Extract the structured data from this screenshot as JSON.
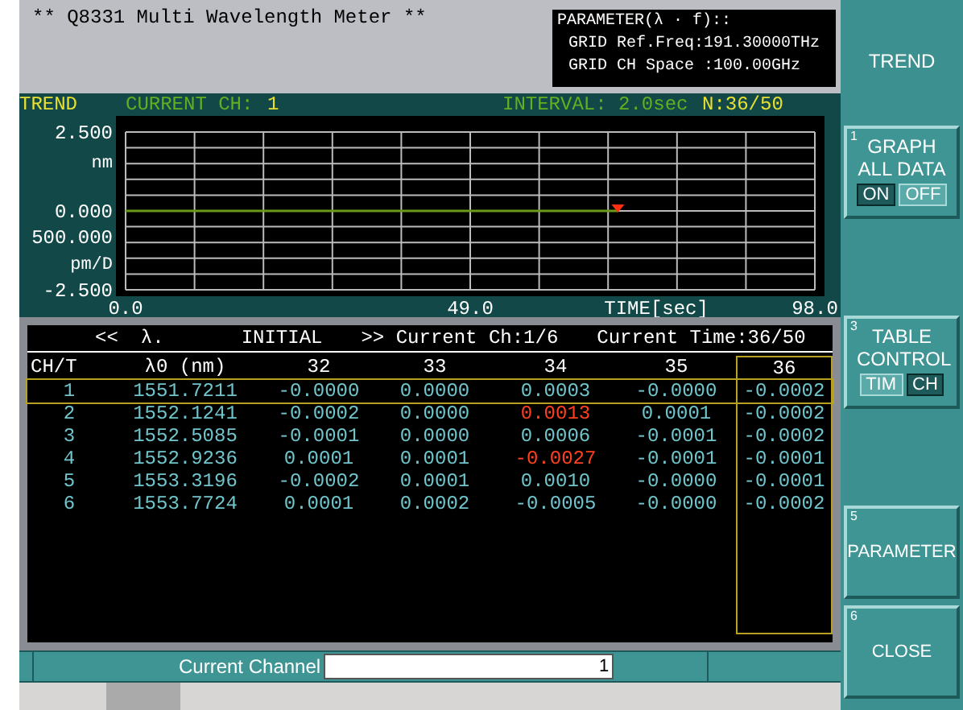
{
  "window": {
    "title": "** Q8331 Multi Wavelength Meter **"
  },
  "parameter_box": {
    "lines": [
      "PARAMETER(λ · f)::",
      "GRID Ref.Freq:191.30000THz",
      "GRID CH Space :100.00GHz"
    ]
  },
  "trend_bar": {
    "mode": "TREND",
    "current_ch_label": "CURRENT CH:",
    "current_ch": "1",
    "interval": "INTERVAL: 2.0sec",
    "count": "N:36/50"
  },
  "chart": {
    "scale2": "500.000",
    "scale2_unit": "pm/D",
    "chart_data": {
      "type": "line",
      "xlabel": "TIME[sec]",
      "ylabel": "nm",
      "xlim": [
        0,
        98
      ],
      "ylim": [
        -2.5,
        2.5
      ],
      "xticks": [
        {
          "value": 0,
          "label": "0.0"
        },
        {
          "value": 49,
          "label": "49.0"
        },
        {
          "value": 98,
          "label": "98.0"
        }
      ],
      "yticks": [
        {
          "value": 2.5,
          "label": "2.500"
        },
        {
          "value": 0,
          "label": "0.000"
        },
        {
          "value": -2.5,
          "label": "-2.500"
        }
      ],
      "x": [
        0,
        70
      ],
      "series": [
        {
          "color": "#6a9a1a",
          "values": [
            0,
            0
          ]
        }
      ]
    }
  },
  "table": {
    "header": [
      "<<",
      "λ.",
      "INITIAL",
      ">> Current Ch:1/6",
      "Current Time:36/50"
    ],
    "columns": [
      {
        "label": "CH/T",
        "selected": false
      },
      {
        "label": "λ0 (nm)",
        "selected": false
      },
      {
        "label": "32",
        "selected": false
      },
      {
        "label": "33",
        "selected": false
      },
      {
        "label": "34",
        "selected": false
      },
      {
        "label": "35",
        "selected": false
      },
      {
        "label": "36",
        "selected": true
      }
    ],
    "rows": [
      {
        "ch": "1",
        "lambda0": "1551.7211",
        "selected": true,
        "values": [
          {
            "text": "-0.0000",
            "alarm": false
          },
          {
            "text": "0.0000",
            "alarm": false
          },
          {
            "text": "0.0003",
            "alarm": false
          },
          {
            "text": "-0.0000",
            "alarm": false
          },
          {
            "text": "-0.0002",
            "alarm": false
          }
        ]
      },
      {
        "ch": "2",
        "lambda0": "1552.1241",
        "selected": false,
        "values": [
          {
            "text": "-0.0002",
            "alarm": false
          },
          {
            "text": "0.0000",
            "alarm": false
          },
          {
            "text": "0.0013",
            "alarm": true
          },
          {
            "text": "0.0001",
            "alarm": false
          },
          {
            "text": "-0.0002",
            "alarm": false
          }
        ]
      },
      {
        "ch": "3",
        "lambda0": "1552.5085",
        "selected": false,
        "values": [
          {
            "text": "-0.0001",
            "alarm": false
          },
          {
            "text": "0.0000",
            "alarm": false
          },
          {
            "text": "0.0006",
            "alarm": false
          },
          {
            "text": "-0.0001",
            "alarm": false
          },
          {
            "text": "-0.0002",
            "alarm": false
          }
        ]
      },
      {
        "ch": "4",
        "lambda0": "1552.9236",
        "selected": false,
        "values": [
          {
            "text": "0.0001",
            "alarm": false
          },
          {
            "text": "0.0001",
            "alarm": false
          },
          {
            "text": "-0.0027",
            "alarm": true
          },
          {
            "text": "-0.0001",
            "alarm": false
          },
          {
            "text": "-0.0001",
            "alarm": false
          }
        ]
      },
      {
        "ch": "5",
        "lambda0": "1553.3196",
        "selected": false,
        "values": [
          {
            "text": "-0.0002",
            "alarm": false
          },
          {
            "text": "0.0001",
            "alarm": false
          },
          {
            "text": "0.0010",
            "alarm": false
          },
          {
            "text": "-0.0000",
            "alarm": false
          },
          {
            "text": "-0.0001",
            "alarm": false
          }
        ]
      },
      {
        "ch": "6",
        "lambda0": "1553.7724",
        "selected": false,
        "values": [
          {
            "text": "0.0001",
            "alarm": false
          },
          {
            "text": "0.0002",
            "alarm": false
          },
          {
            "text": "-0.0005",
            "alarm": false
          },
          {
            "text": "-0.0000",
            "alarm": false
          },
          {
            "text": "-0.0002",
            "alarm": false
          }
        ]
      }
    ]
  },
  "current_channel": {
    "label": "Current Channel",
    "value": "1"
  },
  "side_panel": {
    "title": "TREND",
    "buttons": [
      {
        "kind": "toggle",
        "number": "1",
        "label": "GRAPH ALL DATA",
        "options": [
          {
            "label": "ON",
            "selected": true
          },
          {
            "label": "OFF",
            "selected": false
          }
        ]
      },
      {
        "kind": "blank"
      },
      {
        "kind": "toggle",
        "number": "3",
        "label": "TABLE CONTROL",
        "options": [
          {
            "label": "TIM",
            "selected": false
          },
          {
            "label": "CH",
            "selected": true
          }
        ]
      },
      {
        "kind": "blank"
      },
      {
        "kind": "action",
        "number": "5",
        "label": "PARAMETER"
      },
      {
        "kind": "action",
        "number": "6",
        "label": "CLOSE"
      }
    ]
  }
}
